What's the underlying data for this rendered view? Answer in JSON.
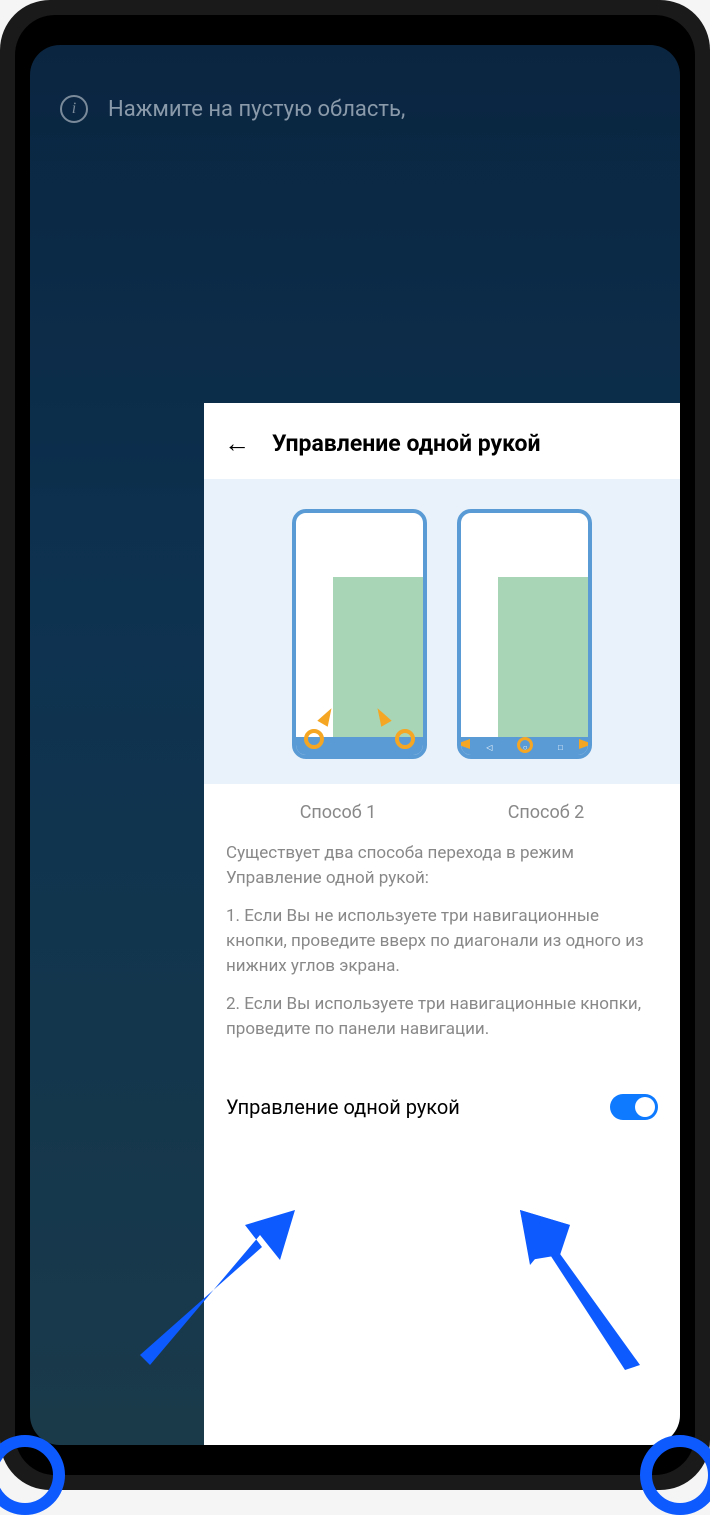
{
  "hint": {
    "text": "Нажмите на пустую область,"
  },
  "panel": {
    "title": "Управление одной рукой",
    "method1_label": "Способ 1",
    "method2_label": "Способ 2",
    "intro": "Существует два способа перехода в режим Управление одной рукой:",
    "step1": "1. Если Вы не используете три навигационные кнопки, проведите вверх по диагонали из одного из нижних углов экрана.",
    "step2": "2. Если Вы используете три навигационные кнопки, проведите по панели навигации.",
    "toggle_label": "Управление одной рукой",
    "toggle_state": true
  }
}
